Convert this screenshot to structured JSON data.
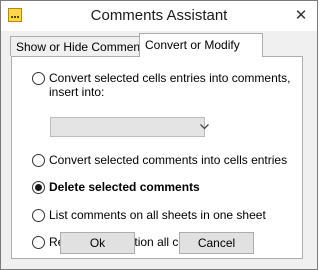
{
  "window": {
    "title": "Comments Assistant",
    "close_glyph": "✕",
    "app_icon": "comments-app-icon"
  },
  "tabs": [
    {
      "label": "Show or Hide Comments",
      "active": false
    },
    {
      "label": "Convert or Modify",
      "active": true
    }
  ],
  "options": [
    {
      "label": "Convert selected cells entries into comments, insert into:",
      "checked": false
    },
    {
      "label": "Convert selected comments into cells entries",
      "checked": false
    },
    {
      "label": "Delete selected comments",
      "checked": true
    },
    {
      "label": "List comments on all sheets in one sheet",
      "checked": false
    },
    {
      "label": "Resize and position all comments",
      "checked": false
    }
  ],
  "insert_into_select": {
    "value": "",
    "enabled": false
  },
  "buttons": {
    "ok": "Ok",
    "cancel": "Cancel"
  }
}
